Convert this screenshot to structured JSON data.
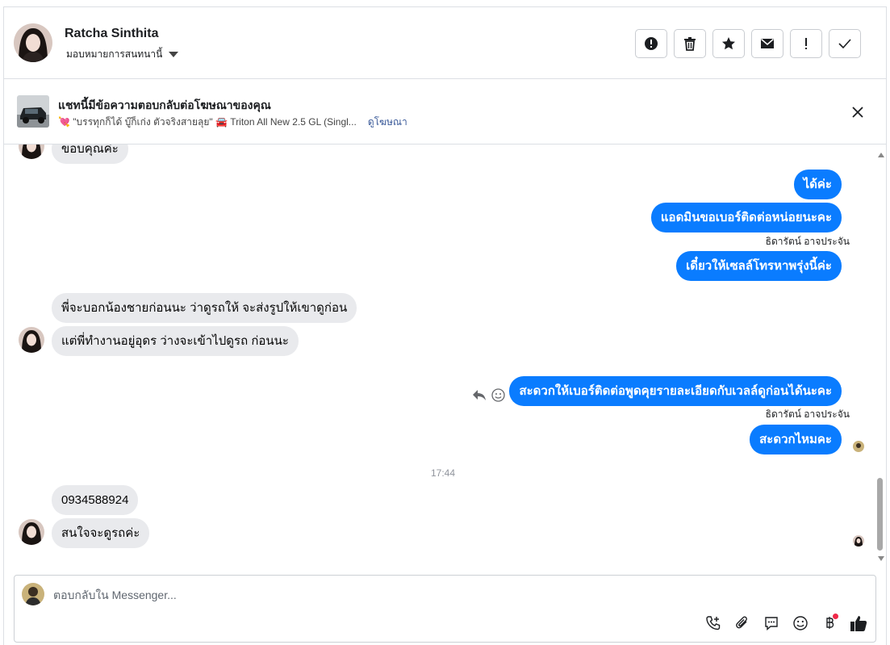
{
  "contact": {
    "name": "Ratcha Sinthita",
    "assign_label": "มอบหมายการสนทนานี้"
  },
  "actions": [
    {
      "icon": "alert-circle-icon"
    },
    {
      "icon": "trash-icon"
    },
    {
      "icon": "star-icon"
    },
    {
      "icon": "envelope-icon"
    },
    {
      "icon": "exclamation-icon"
    },
    {
      "icon": "checkmark-icon"
    }
  ],
  "ad": {
    "title": "แชทนี้มีข้อความตอบกลับต่อโฆษณาของคุณ",
    "subtitle": "💘 \"บรรทุกก็ได้ บู๊ก็เก่ง ตัวจริงสายลุย\" 🚘 Triton All New 2.5 GL (Singl...",
    "link": "ดูโฆษณา"
  },
  "messages": {
    "m0": "ขอบคุณค่ะ",
    "m1": "ได้ค่ะ",
    "m2": "แอดมินขอเบอร์ติดต่อหน่อยนะคะ",
    "sender1": "ธิดารัตน์ อาจประจัน",
    "m3": "เดี๋ยวให้เซลล์โทรหาพรุ่งนี้ค่ะ",
    "m4": "พี่จะบอกน้องชายก่อนนะ ว่าดูรถให้ จะส่งรูปให้เขาดูก่อน",
    "m5": "แต่พี่ทำงานอยู่อุดร ว่างจะเข้าไปดูรถ ก่อนนะ",
    "m6": "สะดวกให้เบอร์ติดต่อพูดคุยรายละเอียดกับเวลล์ดูก่อนได้นะคะ",
    "sender2": "ธิดารัตน์ อาจประจัน",
    "m7": "สะดวกไหมคะ",
    "time": "17:44",
    "m8": "0934588924",
    "m9": "สนใจจะดูรถค่ะ"
  },
  "composer": {
    "placeholder": "ตอบกลับใน Messenger..."
  },
  "colors": {
    "outgoing": "#0a7cff",
    "incoming": "#e9eaed",
    "link": "#385898"
  }
}
